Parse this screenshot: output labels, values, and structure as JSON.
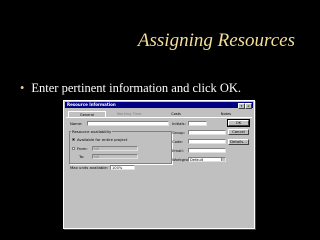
{
  "slide": {
    "title": "Assigning Resources",
    "bullet": "Enter pertinent information and click OK."
  },
  "dialog": {
    "title": "Resource Information",
    "title_buttons": {
      "help": "?",
      "close": "×"
    },
    "tabs": [
      {
        "label": "General",
        "active": true
      },
      {
        "label": "Working Time",
        "active": false,
        "dimmed": true
      },
      {
        "label": "Costs",
        "active": false
      },
      {
        "label": "Notes",
        "active": false
      }
    ],
    "fields": {
      "name_label": "Name:",
      "name_value": "",
      "initials_label": "Initials:",
      "initials_value": "",
      "group_label": "Group:",
      "group_value": "",
      "code_label": "Code:",
      "code_value": "",
      "email_label": "Email:",
      "email_value": "",
      "workgroup_label": "Workgroup:",
      "workgroup_value": "Default"
    },
    "availability": {
      "group_label": "Resource availability",
      "available_entire_label": "Available for entire project",
      "available_entire_checked": true,
      "from_label": "From:",
      "from_value": "NA",
      "from_checked": false,
      "to_label": "To:",
      "to_value": "NA"
    },
    "max_units_label": "Max units available:",
    "max_units_value": "100%",
    "buttons": {
      "ok": "OK",
      "cancel": "Cancel",
      "details": "Details..."
    }
  },
  "colors": {
    "title": "#F3DE9A",
    "background": "#000000",
    "titlebar": "#000080"
  }
}
